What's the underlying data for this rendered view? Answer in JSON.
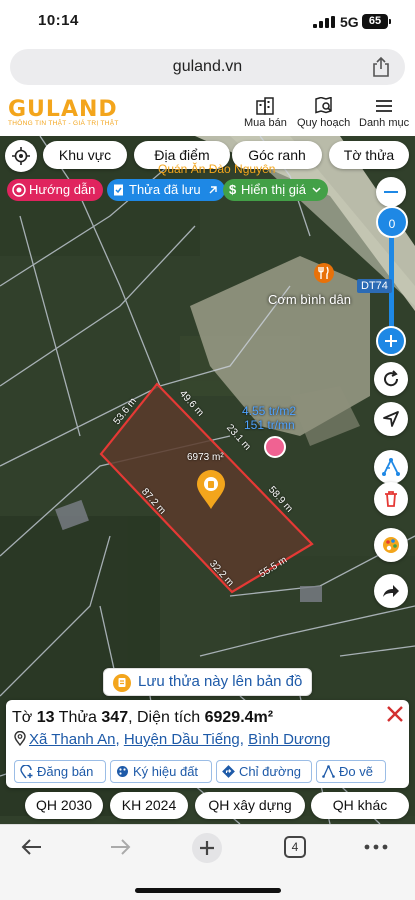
{
  "status": {
    "time": "10:14",
    "network": "5G",
    "battery": "65"
  },
  "browser": {
    "url": "guland.vn"
  },
  "header": {
    "logo": "GULAND",
    "tagline": "THÔNG TIN THẬT - GIÁ TRỊ THẬT",
    "nav": [
      {
        "label": "Mua bán",
        "icon": "buildings-icon"
      },
      {
        "label": "Quy hoạch",
        "icon": "map-search-icon"
      },
      {
        "label": "Danh mục",
        "icon": "menu-icon"
      }
    ]
  },
  "map": {
    "filters": [
      "Khu vực",
      "Địa điểm",
      "Góc ranh",
      "Tờ thửa"
    ],
    "quick": {
      "guide": "Hướng dẫn",
      "saved": "Thửa đã lưu",
      "price": "Hiển thị giá"
    },
    "zoom_value": "0",
    "poi": [
      {
        "name": "Quán Ăn Đào Nguyên"
      },
      {
        "name": "Cơm bình dân"
      }
    ],
    "road_label": "DT74",
    "parcel_area_label": "6973 m²",
    "dimensions": [
      "49.6 m",
      "53.6 m",
      "23.1 m",
      "58.9 m",
      "87.2 m",
      "32.2 m",
      "55.5 m"
    ],
    "price_labels": {
      "per_m2": "4.55 tr/m2",
      "per_mn": "151 tr/mn"
    },
    "save_parcel": "Lưu thửa này lên bản đồ",
    "colors": {
      "parcel_fill": "#5a3b2c",
      "parcel_border": "#e53935",
      "accent": "#1e88e5",
      "brand": "#f3a51c"
    }
  },
  "info": {
    "sheet_label": "Tờ",
    "sheet": "13",
    "parcel_label": "Thửa",
    "parcel": "347",
    "area_label": ", Diện tích",
    "area": "6929.4m²",
    "address": [
      "Xã Thanh An",
      "Huyện Dầu Tiếng",
      "Bình Dương"
    ],
    "actions": [
      "Đăng bán",
      "Ký hiệu đất",
      "Chỉ đường",
      "Đo vẽ"
    ]
  },
  "plans": [
    "QH 2030",
    "KH 2024",
    "QH xây dựng",
    "QH khác"
  ],
  "toolbar": {
    "tab_count": "4"
  }
}
